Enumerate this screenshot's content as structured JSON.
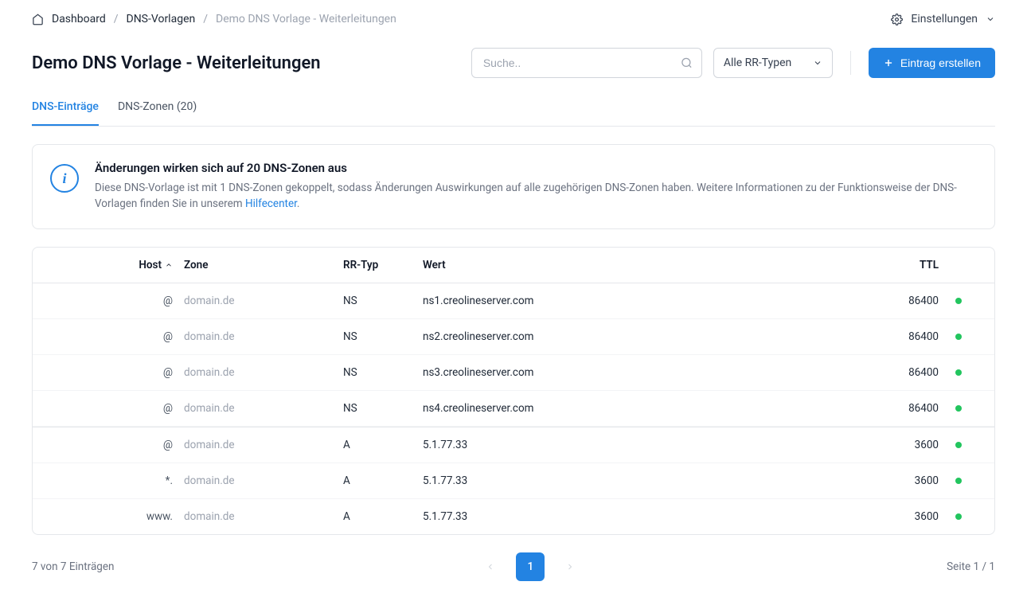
{
  "breadcrumb": {
    "items": [
      "Dashboard",
      "DNS-Vorlagen",
      "Demo DNS Vorlage - Weiterleitungen"
    ]
  },
  "settings_label": "Einstellungen",
  "page_title": "Demo DNS Vorlage - Weiterleitungen",
  "search_placeholder": "Suche..",
  "rr_type_filter": "Alle RR-Typen",
  "create_btn": "Eintrag erstellen",
  "tabs": [
    {
      "label": "DNS-Einträge",
      "active": true
    },
    {
      "label": "DNS-Zonen (20)",
      "active": false
    }
  ],
  "info": {
    "title": "Änderungen wirken sich auf 20 DNS-Zonen aus",
    "text_before": "Diese DNS-Vorlage ist mit 1 DNS-Zonen gekoppelt, sodass Änderungen Auswirkungen auf alle zugehörigen DNS-Zonen haben. Weitere Informationen zu der Funktionsweise der DNS-Vorlagen finden Sie in unserem ",
    "link": "Hilfecenter",
    "text_after": "."
  },
  "columns": {
    "host": "Host",
    "zone": "Zone",
    "rrtype": "RR-Typ",
    "wert": "Wert",
    "ttl": "TTL"
  },
  "rows": [
    {
      "host": "@",
      "zone": "domain.de",
      "rrtype": "NS",
      "wert": "ns1.creolineserver.com",
      "ttl": "86400",
      "status": "green",
      "group_start": false
    },
    {
      "host": "@",
      "zone": "domain.de",
      "rrtype": "NS",
      "wert": "ns2.creolineserver.com",
      "ttl": "86400",
      "status": "green",
      "group_start": false
    },
    {
      "host": "@",
      "zone": "domain.de",
      "rrtype": "NS",
      "wert": "ns3.creolineserver.com",
      "ttl": "86400",
      "status": "green",
      "group_start": false
    },
    {
      "host": "@",
      "zone": "domain.de",
      "rrtype": "NS",
      "wert": "ns4.creolineserver.com",
      "ttl": "86400",
      "status": "green",
      "group_start": false
    },
    {
      "host": "@",
      "zone": "domain.de",
      "rrtype": "A",
      "wert": "5.1.77.33",
      "ttl": "3600",
      "status": "green",
      "group_start": true
    },
    {
      "host": "*.",
      "zone": "domain.de",
      "rrtype": "A",
      "wert": "5.1.77.33",
      "ttl": "3600",
      "status": "green",
      "group_start": false
    },
    {
      "host": "www.",
      "zone": "domain.de",
      "rrtype": "A",
      "wert": "5.1.77.33",
      "ttl": "3600",
      "status": "green",
      "group_start": false
    }
  ],
  "footer": {
    "count": "7 von 7 Einträgen",
    "current_page": "1",
    "page_info": "Seite 1 / 1"
  }
}
